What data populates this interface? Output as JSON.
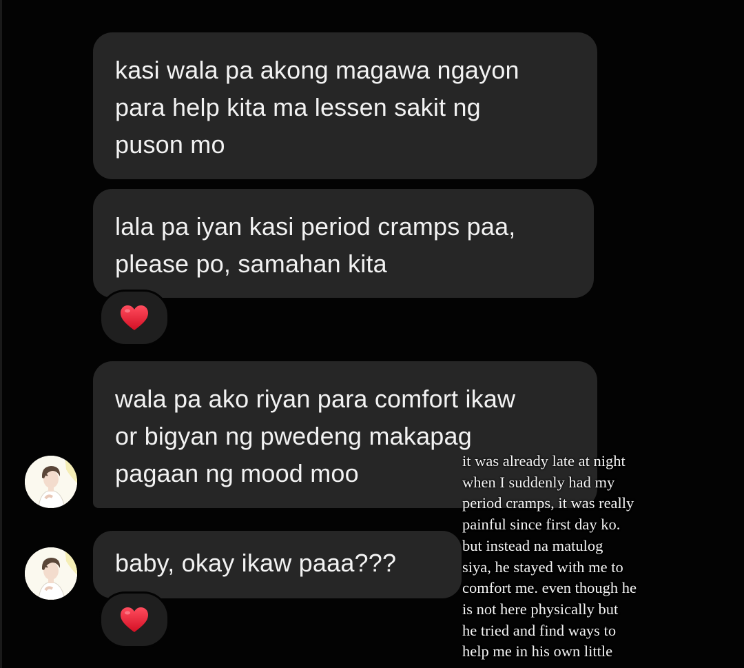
{
  "messages": [
    {
      "lines": [
        "kasi wala pa akong magawa ngayon",
        "para help kita ma lessen sakit ng",
        "puson mo"
      ]
    },
    {
      "lines": [
        "lala pa iyan kasi period cramps paa,",
        "please po, samahan kita"
      ],
      "reaction": "❤️"
    },
    {
      "lines": [
        "wala pa ako riyan para comfort ikaw",
        "or bigyan ng pwedeng makapag",
        "pagaan ng mood moo"
      ]
    },
    {
      "lines": [
        "baby, okay ikaw paaa???"
      ],
      "reaction": "❤️"
    }
  ],
  "avatars": [
    {
      "icon": "contact-avatar"
    },
    {
      "icon": "contact-avatar"
    }
  ],
  "caption": {
    "lines": [
      "it was already late at night",
      "when I suddenly had my",
      "period cramps, it was really",
      "painful since first day ko.",
      "but instead na matulog",
      "siya, he stayed with me to",
      "comfort me. even though he",
      "is not here physically but",
      "he tried and find ways to",
      "help me in his own little"
    ]
  },
  "colors": {
    "background": "#030303",
    "bubble": "#262626",
    "text": "#f2f2f2",
    "heart": "#e0112b"
  }
}
